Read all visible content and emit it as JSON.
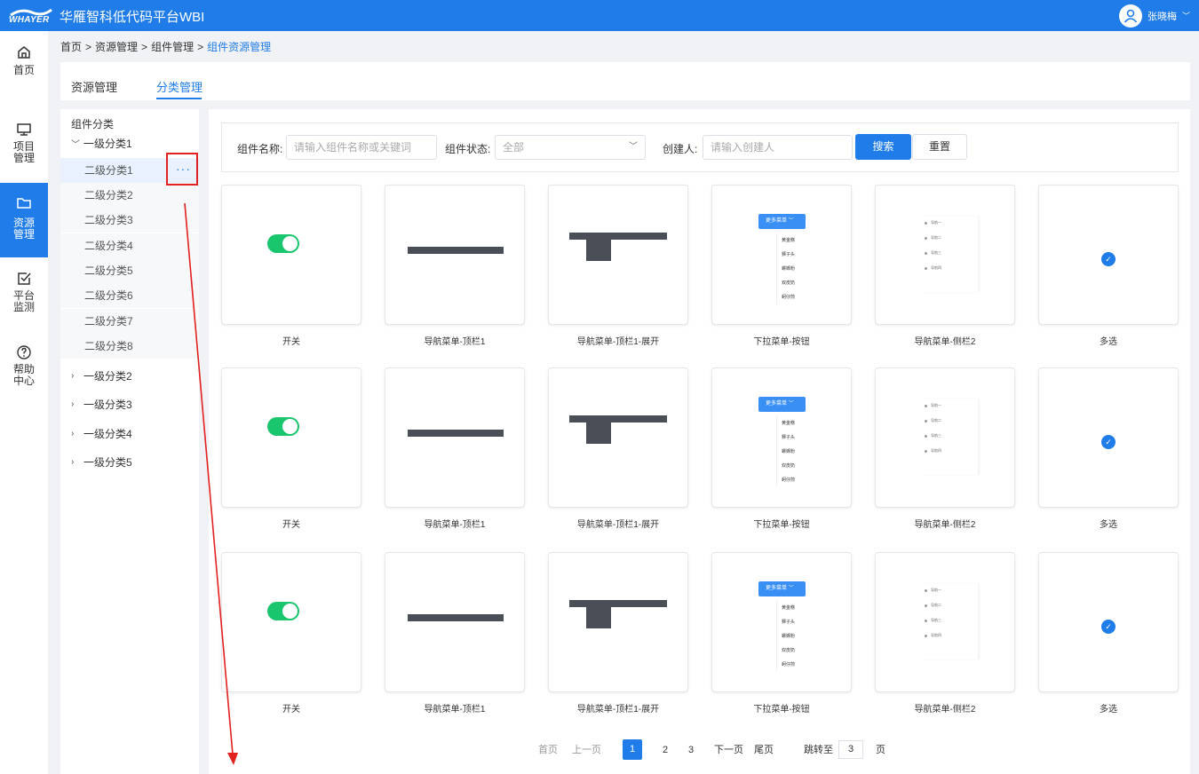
{
  "header": {
    "logo_text": "WHAYER",
    "title": "华雁智科低代码平台WBI",
    "user_name": "张晓梅"
  },
  "sidebar": {
    "items": [
      {
        "icon": "home-icon",
        "label": "首页"
      },
      {
        "icon": "monitor-icon",
        "label": "项目管理"
      },
      {
        "icon": "folder-icon",
        "label": "资源管理",
        "active": true
      },
      {
        "icon": "checkbox-icon",
        "label": "平台监测"
      },
      {
        "icon": "help-circle-icon",
        "label": "帮助中心"
      }
    ]
  },
  "breadcrumb": [
    "首页",
    "资源管理",
    "组件管理",
    "组件资源管理"
  ],
  "breadcrumb_sep": ">",
  "tabs": [
    {
      "label": "资源管理"
    },
    {
      "label": "分类管理",
      "active": true
    }
  ],
  "tree": {
    "title": "组件分类",
    "groups": [
      {
        "label": "一级分类1",
        "expanded": true,
        "children": [
          "二级分类1",
          "二级分类2",
          "二级分类3",
          "二级分类4",
          "二级分类5",
          "二级分类6",
          "二级分类7",
          "二级分类8"
        ]
      },
      {
        "label": "一级分类2"
      },
      {
        "label": "一级分类3"
      },
      {
        "label": "一级分类4"
      },
      {
        "label": "一级分类5"
      }
    ],
    "more_icon": "more-dots-icon"
  },
  "filter": {
    "name_label": "组件名称:",
    "name_placeholder": "请输入组件名称或关键词",
    "status_label": "组件状态:",
    "status_value": "全部",
    "creator_label": "创建人:",
    "creator_placeholder": "请输入创建人",
    "search_button": "搜索",
    "reset_button": "重置"
  },
  "cards": [
    {
      "label": "开关",
      "kind": "toggle"
    },
    {
      "label": "导航菜单-顶栏1",
      "kind": "navbar"
    },
    {
      "label": "导航菜单-顶栏1-展开",
      "kind": "navbar-expanded"
    },
    {
      "label": "下拉菜单-按钮",
      "kind": "dropdown"
    },
    {
      "label": "导航菜单-侧栏2",
      "kind": "sidenav"
    },
    {
      "label": "多选",
      "kind": "checkbox"
    }
  ],
  "dropdown_preview": {
    "button": "更多菜单",
    "items": [
      "黄金糕",
      "狮子头",
      "螺蛳粉",
      "双皮奶",
      "蚵仔煎"
    ]
  },
  "sidenav_preview": {
    "items": [
      "导航一",
      "导航二",
      "导航三",
      "导航四"
    ]
  },
  "pagination": {
    "first": "首页",
    "prev": "上一页",
    "pages": [
      "1",
      "2",
      "3"
    ],
    "current": "1",
    "next": "下一页",
    "last": "尾页",
    "jump_label": "跳转至",
    "jump_value": "3",
    "page_suffix": "页"
  },
  "colors": {
    "primary": "#1f7ce8",
    "annotation": "#e1201f",
    "toggle_on": "#19c56d"
  }
}
